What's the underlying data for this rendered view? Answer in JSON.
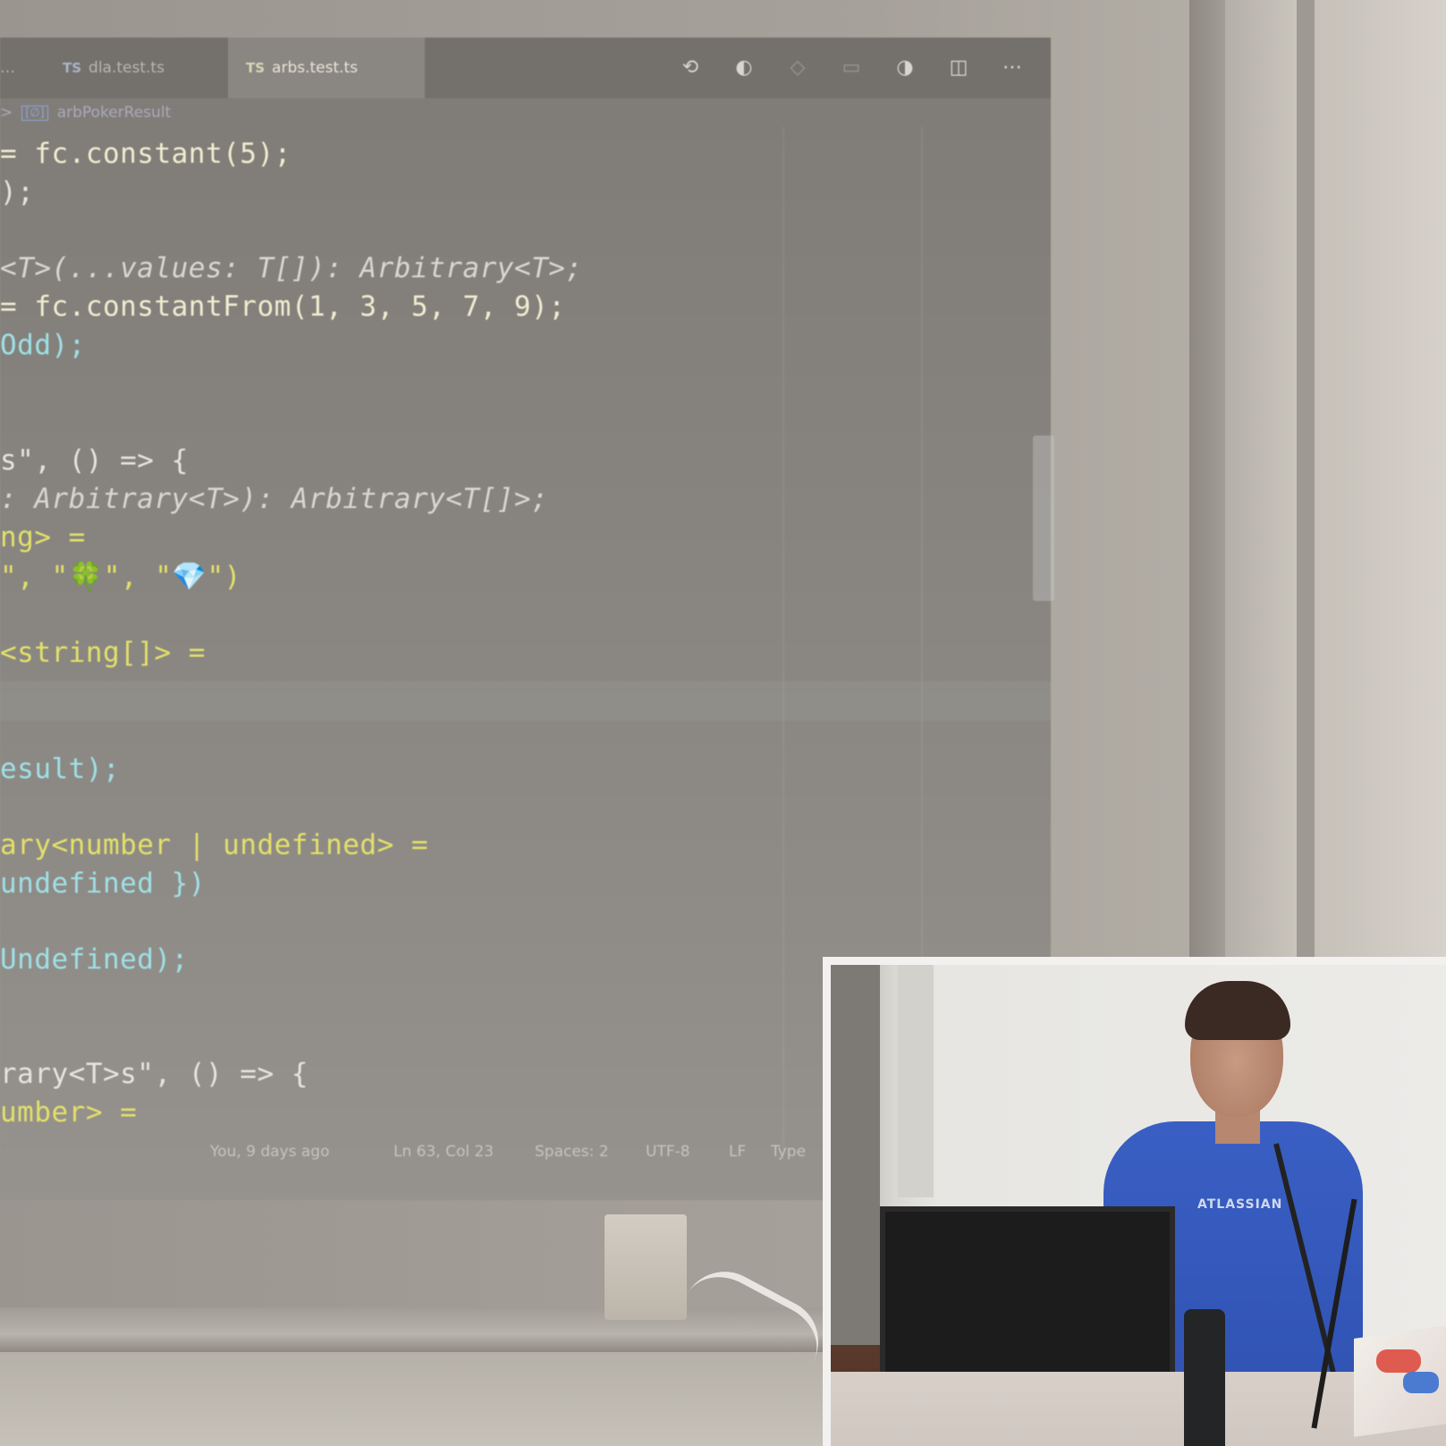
{
  "editor": {
    "tabs": [
      {
        "label": "…",
        "lang": "",
        "active": false
      },
      {
        "label": "dla.test.ts",
        "lang": "TS",
        "active": false
      },
      {
        "label": "arbs.test.ts",
        "lang": "TS",
        "active": true
      }
    ],
    "toolbar_icons": [
      "compare-changes-icon",
      "go-back-icon",
      "go-forward-icon",
      "toggle-icon",
      "run-icon",
      "split-editor-icon",
      "more-icon"
    ],
    "toolbar_glyphs": [
      "⟲",
      "◐",
      "◇",
      "▭",
      "◑",
      "◫",
      "⋯"
    ],
    "breadcrumb": {
      "separator": ">",
      "symbol_badge": "[∅]",
      "symbol": "arbPokerResult"
    },
    "code_lines": [
      {
        "text": "= fc.constant(5);"
      },
      {
        "text": ");"
      },
      {
        "text": "<T>(...values: T[]): Arbitrary<T>;"
      },
      {
        "text": "= fc.constantFrom(1, 3, 5, 7, 9);"
      },
      {
        "text": "Odd);"
      },
      {
        "text": "s\", () => {"
      },
      {
        "text": ": Arbitrary<T>): Arbitrary<T[]>;"
      },
      {
        "text": "ng> ="
      },
      {
        "text": "\", \"🍀\", \"💎\")"
      },
      {
        "text": "<string[]> ="
      },
      {
        "text": "esult);"
      },
      {
        "text": "ary<number | undefined> ="
      },
      {
        "text": "undefined })"
      },
      {
        "text": "Undefined);"
      },
      {
        "text": "rary<T>s\", () => {"
      },
      {
        "text": "umber> ="
      }
    ],
    "status_bar": {
      "blame": "You, 9 days ago",
      "position": "Ln 63, Col 23",
      "spaces": "Spaces: 2",
      "encoding": "UTF-8",
      "eol": "LF",
      "language": "Type"
    }
  },
  "webcam": {
    "shirt_text": "ATLASSIAN"
  }
}
